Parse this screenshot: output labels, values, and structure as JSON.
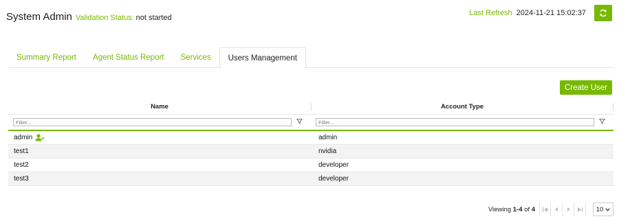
{
  "header": {
    "title": "System Admin",
    "validation_label": "Validation Status:",
    "validation_value": "not started",
    "last_refresh_label": "Last Refresh",
    "last_refresh_time": "2024-11-21 15:02:37",
    "refresh_icon": "refresh-icon"
  },
  "tabs": [
    {
      "label": "Summary Report",
      "active": false
    },
    {
      "label": "Agent Status Report",
      "active": false
    },
    {
      "label": "Services",
      "active": false
    },
    {
      "label": "Users Management",
      "active": true
    }
  ],
  "toolbar": {
    "create_user_label": "Create User"
  },
  "table": {
    "columns": [
      "Name",
      "Account Type"
    ],
    "filter_placeholder": "Filter...",
    "rows": [
      {
        "name": "admin",
        "account_type": "admin",
        "icon": "user-check-icon"
      },
      {
        "name": "test1",
        "account_type": "nvidia"
      },
      {
        "name": "test2",
        "account_type": "developer"
      },
      {
        "name": "test3",
        "account_type": "developer"
      }
    ]
  },
  "pagination": {
    "viewing_prefix": "Viewing",
    "range": "1-4",
    "of_word": "of",
    "total": "4",
    "page_size": "10"
  },
  "colors": {
    "accent": "#76b900",
    "text": "#222222",
    "row_alt": "#f3f3f3"
  }
}
